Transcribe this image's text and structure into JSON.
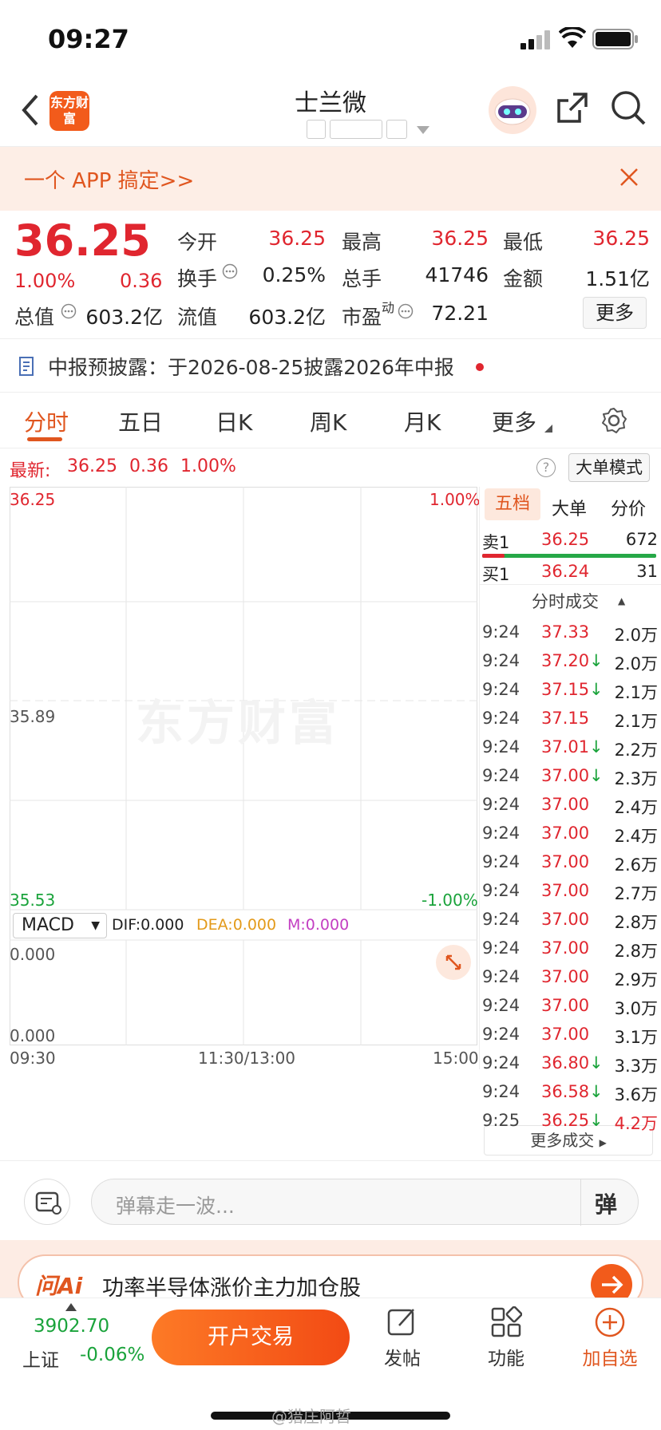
{
  "status": {
    "time": "09:27"
  },
  "header": {
    "title": "士兰微"
  },
  "banner": {
    "text": "一个 APP 搞定>>"
  },
  "logo_text": "东方财富",
  "quote": {
    "price": "36.25",
    "pct": "1.00%",
    "change": "0.36",
    "rows": [
      [
        {
          "l": "今开",
          "v": "36.25",
          "c": "red"
        },
        {
          "l": "最高",
          "v": "36.25",
          "c": "red"
        },
        {
          "l": "最低",
          "v": "36.25",
          "c": "red"
        }
      ],
      [
        {
          "l": "换手",
          "v": "0.25%",
          "c": "dark"
        },
        {
          "l": "总手",
          "v": "41746",
          "c": "dark"
        },
        {
          "l": "金额",
          "v": "1.51亿",
          "c": "dark"
        }
      ],
      [
        {
          "l": "总值",
          "v": "603.2亿",
          "c": "dark"
        },
        {
          "l": "流值",
          "v": "603.2亿",
          "c": "dark"
        },
        {
          "l": "市盈",
          "v": "72.21",
          "c": "dark"
        }
      ]
    ],
    "pe_sup": "动",
    "more_label": "更多"
  },
  "notice": {
    "text": "中报预披露：于2026-08-25披露2026年中报"
  },
  "tabs": [
    "分时",
    "五日",
    "日K",
    "周K",
    "月K",
    "更多"
  ],
  "chart": {
    "latest_label": "最新:",
    "latest_price": "36.25",
    "latest_change": "0.36",
    "latest_pct": "1.00%",
    "mode_button": "大单模式",
    "help_icon": "?",
    "top_price": "36.25",
    "top_pct": "1.00%",
    "mid_price": "35.89",
    "bottom_price": "35.53",
    "bottom_pct": "-1.00%",
    "watermark": "东方财富",
    "macd_select": "MACD",
    "dif": "DIF:0.000",
    "dea": "DEA:0.000",
    "m": "M:0.000",
    "macd_top": "0.000",
    "macd_bottom": "0.000",
    "time_start": "09:30",
    "time_mid": "11:30/13:00",
    "time_end": "15:00"
  },
  "side": {
    "tabs": [
      "五档",
      "大单",
      "分价"
    ],
    "sell": {
      "label": "卖1",
      "price": "36.25",
      "vol": "672"
    },
    "buy": {
      "label": "买1",
      "price": "36.24",
      "vol": "31"
    },
    "trades_header": "分时成交",
    "trades": [
      {
        "t": "9:24",
        "p": "37.33",
        "v": "2.0万",
        "d": ""
      },
      {
        "t": "9:24",
        "p": "37.20",
        "v": "2.0万",
        "d": "↓"
      },
      {
        "t": "9:24",
        "p": "37.15",
        "v": "2.1万",
        "d": "↓"
      },
      {
        "t": "9:24",
        "p": "37.15",
        "v": "2.1万",
        "d": ""
      },
      {
        "t": "9:24",
        "p": "37.01",
        "v": "2.2万",
        "d": "↓"
      },
      {
        "t": "9:24",
        "p": "37.00",
        "v": "2.3万",
        "d": "↓"
      },
      {
        "t": "9:24",
        "p": "37.00",
        "v": "2.4万",
        "d": ""
      },
      {
        "t": "9:24",
        "p": "37.00",
        "v": "2.4万",
        "d": ""
      },
      {
        "t": "9:24",
        "p": "37.00",
        "v": "2.6万",
        "d": ""
      },
      {
        "t": "9:24",
        "p": "37.00",
        "v": "2.7万",
        "d": ""
      },
      {
        "t": "9:24",
        "p": "37.00",
        "v": "2.8万",
        "d": ""
      },
      {
        "t": "9:24",
        "p": "37.00",
        "v": "2.8万",
        "d": ""
      },
      {
        "t": "9:24",
        "p": "37.00",
        "v": "2.9万",
        "d": ""
      },
      {
        "t": "9:24",
        "p": "37.00",
        "v": "3.0万",
        "d": ""
      },
      {
        "t": "9:24",
        "p": "37.00",
        "v": "3.1万",
        "d": ""
      },
      {
        "t": "9:24",
        "p": "36.80",
        "v": "3.3万",
        "d": "↓"
      },
      {
        "t": "9:24",
        "p": "36.58",
        "v": "3.6万",
        "d": "↓"
      },
      {
        "t": "9:25",
        "p": "36.25",
        "v": "4.2万",
        "d": "↓"
      }
    ],
    "more_trades": "更多成交"
  },
  "comment": {
    "placeholder": "弹幕走一波...",
    "danmu_label": "弹"
  },
  "ai_bar": {
    "brand": "问Ai",
    "text": "功率半导体涨价主力加仓股"
  },
  "bottom_nav": {
    "index_value": "3902.70",
    "index_name": "上证",
    "index_pct": "-0.06%",
    "trade_button": "开户交易",
    "post": "发帖",
    "func": "功能",
    "add": "加自选"
  },
  "footer_watermark": "@猎庄阿哲"
}
